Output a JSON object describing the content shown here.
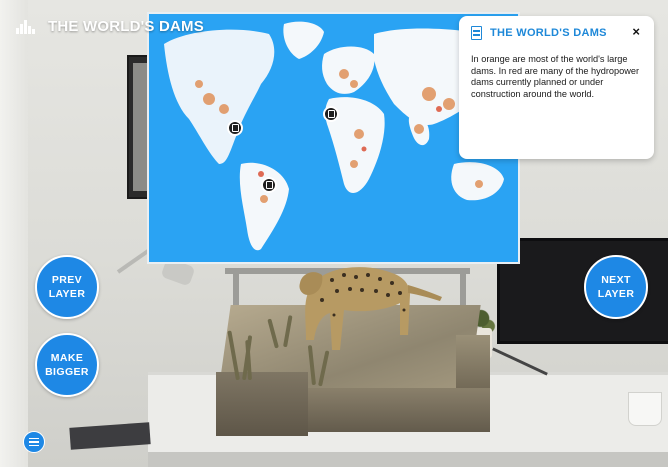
{
  "header": {
    "title": "THE WORLD'S DAMS",
    "icon": "dam-icon"
  },
  "info_panel": {
    "title": "THE WORLD'S DAMS",
    "icon": "document-icon",
    "close_label": "×",
    "body": "In orange are most of the world's large dams. In red are many of the hydropower dams currently planned or under construction around the world."
  },
  "buttons": {
    "prev_line1": "PREV",
    "prev_line2": "LAYER",
    "make_line1": "MAKE",
    "make_line2": "BIGGER",
    "next_line1": "NEXT",
    "next_line2": "LAYER",
    "menu_icon": "hamburger-menu-icon"
  },
  "map": {
    "ocean_color": "#2aa3f3",
    "land_color": "#ffffff",
    "dam_color": "#e0915a",
    "pins": [
      "north-america-dam-pin",
      "europe-dam-pin",
      "south-america-dam-pin"
    ]
  },
  "colors": {
    "accent": "#1e88e5",
    "title_blue": "#1e88d8"
  }
}
